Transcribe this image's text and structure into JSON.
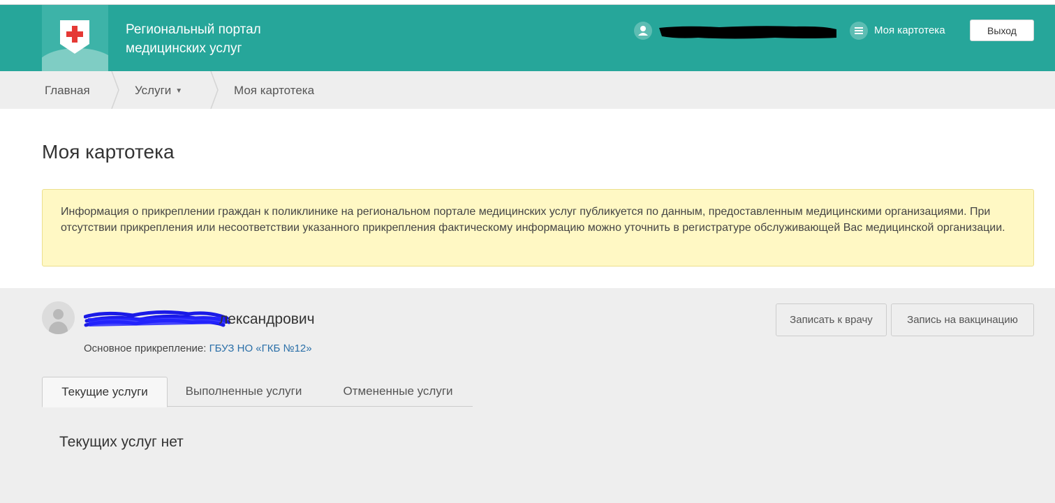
{
  "header": {
    "site_title_line1": "Региональный портал",
    "site_title_line2": "медицинских услуг",
    "my_card_label": "Моя картотека",
    "logout_label": "Выход"
  },
  "breadcrumb": {
    "items": [
      {
        "label": "Главная"
      },
      {
        "label": "Услуги",
        "has_dropdown": true
      },
      {
        "label": "Моя картотека"
      }
    ]
  },
  "page": {
    "title": "Моя картотека",
    "notice": "Информация о прикреплении граждан к поликлинике на региональном портале медицинских услуг публикуется по данным, предоставленным медицинскими организациями. При отсутствии прикрепления или несоответствии указанного прикрепления фактическому информацию можно уточнить в регистратуре обслуживающей Вас медицинской организации."
  },
  "patient": {
    "name_visible": "лександрович",
    "attachment_label": "Основное прикрепление:",
    "attachment_org": "ГБУЗ НО «ГКБ №12»"
  },
  "actions": {
    "book_doctor": "Записать к врачу",
    "book_vaccination": "Запись на вакцинацию"
  },
  "tabs": [
    {
      "label": "Текущие услуги",
      "active": true
    },
    {
      "label": "Выполненные услуги",
      "active": false
    },
    {
      "label": "Отмененные услуги",
      "active": false
    }
  ],
  "empty_message": "Текущих услуг нет",
  "colors": {
    "header_bg": "#26a69a",
    "notice_bg": "#fff8c4",
    "link": "#2a6fa8",
    "cross": "#e53935"
  }
}
